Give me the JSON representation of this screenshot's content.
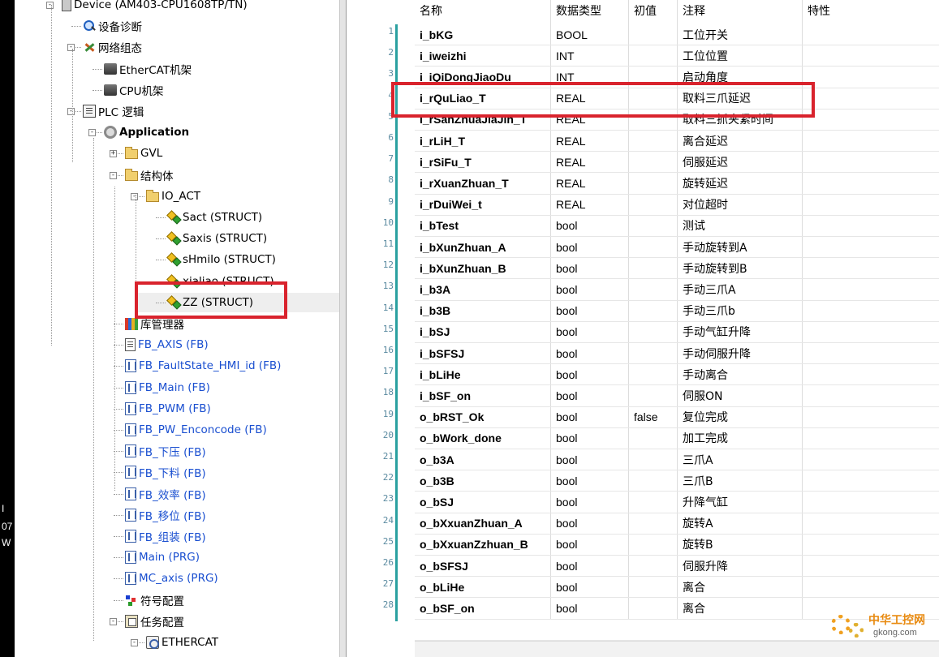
{
  "left_strip": {
    "lines": [
      "I",
      "07",
      "W"
    ]
  },
  "tree": {
    "items": [
      {
        "label": "Device (AM403-CPU1608TP/TN)",
        "icon": "device-icon",
        "level": 0,
        "expander": "-",
        "style": "normal"
      },
      {
        "label": "设备诊断",
        "icon": "diagnostics-icon",
        "level": 1,
        "expander": "",
        "style": "normal"
      },
      {
        "label": "网络组态",
        "icon": "network-config-icon",
        "level": 1,
        "expander": "-",
        "style": "normal"
      },
      {
        "label": "EtherCAT机架",
        "icon": "rack-icon",
        "level": 2,
        "expander": "",
        "style": "normal"
      },
      {
        "label": "CPU机架",
        "icon": "rack-icon",
        "level": 2,
        "expander": "",
        "style": "normal"
      },
      {
        "label": "PLC 逻辑",
        "icon": "plc-logic-icon",
        "level": 1,
        "expander": "-",
        "style": "normal"
      },
      {
        "label": "Application",
        "icon": "application-gear-icon",
        "level": 2,
        "expander": "-",
        "style": "app"
      },
      {
        "label": "GVL",
        "icon": "folder-icon",
        "level": 3,
        "expander": "+",
        "style": "normal"
      },
      {
        "label": "结构体",
        "icon": "folder-icon",
        "level": 3,
        "expander": "-",
        "style": "normal"
      },
      {
        "label": "IO_ACT",
        "icon": "folder-icon",
        "level": 4,
        "expander": "-",
        "style": "normal"
      },
      {
        "label": "Sact (STRUCT)",
        "icon": "struct-icon",
        "level": 5,
        "expander": "",
        "style": "normal"
      },
      {
        "label": "Saxis (STRUCT)",
        "icon": "struct-icon",
        "level": 5,
        "expander": "",
        "style": "normal"
      },
      {
        "label": "sHmiIo (STRUCT)",
        "icon": "struct-icon",
        "level": 5,
        "expander": "",
        "style": "normal"
      },
      {
        "label": "xialiao (STRUCT)",
        "icon": "struct-icon",
        "level": 5,
        "expander": "",
        "style": "normal"
      },
      {
        "label": "ZZ (STRUCT)",
        "icon": "struct-icon",
        "level": 5,
        "expander": "",
        "style": "selected"
      },
      {
        "label": "库管理器",
        "icon": "library-manager-icon",
        "level": 3,
        "expander": "",
        "style": "normal"
      },
      {
        "label": "FB_AXIS (FB)",
        "icon": "document-icon",
        "level": 3,
        "expander": "",
        "style": "link"
      },
      {
        "label": "FB_FaultState_HMI_id (FB)",
        "icon": "function-block-icon",
        "level": 3,
        "expander": "",
        "style": "link"
      },
      {
        "label": "FB_Main (FB)",
        "icon": "function-block-icon",
        "level": 3,
        "expander": "",
        "style": "link"
      },
      {
        "label": "FB_PWM (FB)",
        "icon": "function-block-icon",
        "level": 3,
        "expander": "",
        "style": "link"
      },
      {
        "label": "FB_PW_Enconcode (FB)",
        "icon": "function-block-icon",
        "level": 3,
        "expander": "",
        "style": "link"
      },
      {
        "label": "FB_下压 (FB)",
        "icon": "function-block-icon",
        "level": 3,
        "expander": "",
        "style": "link"
      },
      {
        "label": "FB_下料 (FB)",
        "icon": "function-block-icon",
        "level": 3,
        "expander": "",
        "style": "link"
      },
      {
        "label": "FB_效率 (FB)",
        "icon": "function-block-icon",
        "level": 3,
        "expander": "",
        "style": "link"
      },
      {
        "label": "FB_移位 (FB)",
        "icon": "function-block-icon",
        "level": 3,
        "expander": "",
        "style": "link"
      },
      {
        "label": "FB_组装 (FB)",
        "icon": "function-block-icon",
        "level": 3,
        "expander": "",
        "style": "link"
      },
      {
        "label": "Main (PRG)",
        "icon": "function-block-icon",
        "level": 3,
        "expander": "",
        "style": "link"
      },
      {
        "label": "MC_axis (PRG)",
        "icon": "function-block-icon",
        "level": 3,
        "expander": "",
        "style": "link"
      },
      {
        "label": "符号配置",
        "icon": "symbol-config-icon",
        "level": 3,
        "expander": "",
        "style": "normal"
      },
      {
        "label": "任务配置",
        "icon": "task-config-icon",
        "level": 3,
        "expander": "-",
        "style": "normal"
      },
      {
        "label": "ETHERCAT",
        "icon": "ethercat-task-icon",
        "level": 4,
        "expander": "-",
        "style": "normal"
      }
    ]
  },
  "grid": {
    "collapse_mark": "^",
    "headers": [
      "名称",
      "数据类型",
      "初值",
      "注释",
      "特性"
    ],
    "rows": [
      {
        "num": "1",
        "name": "i_bKG",
        "type": "BOOL",
        "init": "",
        "comment": "工位开关"
      },
      {
        "num": "2",
        "name": "i_iweizhi",
        "type": "INT",
        "init": "",
        "comment": "工位位置"
      },
      {
        "num": "3",
        "name": "i_iQiDongJiaoDu",
        "type": "INT",
        "init": "",
        "comment": "启动角度"
      },
      {
        "num": "4",
        "name": "i_rQuLiao_T",
        "type": "REAL",
        "init": "",
        "comment": "取料三爪延迟"
      },
      {
        "num": "5",
        "name": "i_rSanZhuaJiaJin_T",
        "type": "REAL",
        "init": "",
        "comment": "取料三抓夹紧时间"
      },
      {
        "num": "6",
        "name": "i_rLiH_T",
        "type": "REAL",
        "init": "",
        "comment": "离合延迟"
      },
      {
        "num": "7",
        "name": "i_rSiFu_T",
        "type": "REAL",
        "init": "",
        "comment": "伺服延迟"
      },
      {
        "num": "8",
        "name": "i_rXuanZhuan_T",
        "type": "REAL",
        "init": "",
        "comment": "旋转延迟"
      },
      {
        "num": "9",
        "name": "i_rDuiWei_t",
        "type": "REAL",
        "init": "",
        "comment": "对位超时"
      },
      {
        "num": "10",
        "name": "i_bTest",
        "type": "bool",
        "init": "",
        "comment": "测试"
      },
      {
        "num": "11",
        "name": "i_bXunZhuan_A",
        "type": "bool",
        "init": "",
        "comment": "手动旋转到A"
      },
      {
        "num": "12",
        "name": "i_bXunZhuan_B",
        "type": "bool",
        "init": "",
        "comment": "手动旋转到B"
      },
      {
        "num": "13",
        "name": "i_b3A",
        "type": "bool",
        "init": "",
        "comment": "手动三爪A"
      },
      {
        "num": "14",
        "name": "i_b3B",
        "type": "bool",
        "init": "",
        "comment": "手动三爪b"
      },
      {
        "num": "15",
        "name": "i_bSJ",
        "type": "bool",
        "init": "",
        "comment": "手动气缸升降"
      },
      {
        "num": "16",
        "name": "i_bSFSJ",
        "type": "bool",
        "init": "",
        "comment": "手动伺服升降"
      },
      {
        "num": "17",
        "name": "i_bLiHe",
        "type": "bool",
        "init": "",
        "comment": "手动离合"
      },
      {
        "num": "18",
        "name": "i_bSF_on",
        "type": "bool",
        "init": "",
        "comment": "伺服ON"
      },
      {
        "num": "19",
        "name": "o_bRST_Ok",
        "type": "bool",
        "init": "false",
        "comment": "复位完成"
      },
      {
        "num": "20",
        "name": "o_bWork_done",
        "type": "bool",
        "init": "",
        "comment": "加工完成"
      },
      {
        "num": "21",
        "name": "o_b3A",
        "type": "bool",
        "init": "",
        "comment": "三爪A"
      },
      {
        "num": "22",
        "name": "o_b3B",
        "type": "bool",
        "init": "",
        "comment": "三爪B"
      },
      {
        "num": "23",
        "name": "o_bSJ",
        "type": "bool",
        "init": "",
        "comment": "升降气缸"
      },
      {
        "num": "24",
        "name": "o_bXxuanZhuan_A",
        "type": "bool",
        "init": "",
        "comment": "旋转A"
      },
      {
        "num": "25",
        "name": "o_bXxuanZzhuan_B",
        "type": "bool",
        "init": "",
        "comment": "旋转B"
      },
      {
        "num": "26",
        "name": "o_bSFSJ",
        "type": "bool",
        "init": "",
        "comment": "伺服升降"
      },
      {
        "num": "27",
        "name": "o_bLiHe",
        "type": "bool",
        "init": "",
        "comment": "离合"
      },
      {
        "num": "28",
        "name": "o_bSF_on",
        "type": "bool",
        "init": "",
        "comment": "离合"
      }
    ]
  },
  "watermark": {
    "text": "中华工控网",
    "url": "gkong.com"
  },
  "colors": {
    "highlight_red": "#d9232d",
    "link_blue": "#1a4fd0",
    "gutter_teal": "#2aa0a0"
  }
}
